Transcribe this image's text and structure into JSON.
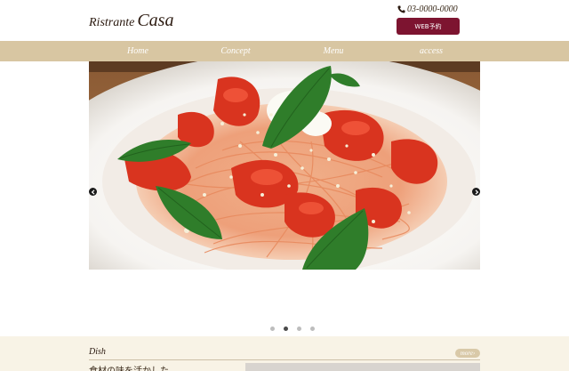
{
  "brand": {
    "name_part1": "Ristrante",
    "name_part2": "Casa"
  },
  "contact": {
    "phone": "03-0000-0000",
    "web_reserve_label": "WEB予約"
  },
  "nav": {
    "items": [
      "Home",
      "Concept",
      "Menu",
      "access"
    ]
  },
  "hero": {
    "slide_count": 4,
    "active_slide": 2
  },
  "dish": {
    "title": "Dish",
    "more_label": "more",
    "intro_text": "食材の味を活かした"
  },
  "colors": {
    "nav_bg": "#d8c6a2",
    "reserve_btn": "#7d1430",
    "section_bg": "#f8f3e6"
  }
}
